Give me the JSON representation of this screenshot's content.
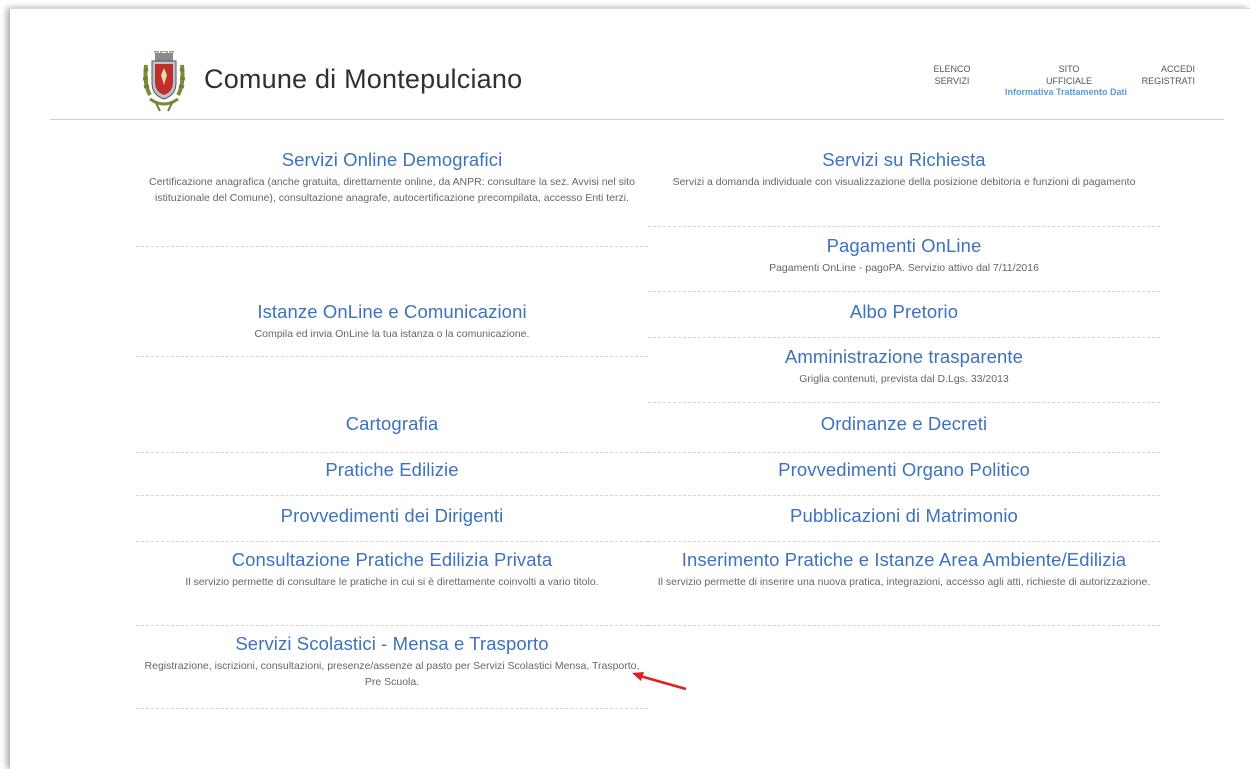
{
  "header": {
    "site_title": "Comune di Montepulciano",
    "nav": {
      "elenco_line1": "ELENCO",
      "elenco_line2": "SERVIZI",
      "sito_line1": "SITO",
      "sito_line2": "UFFICIALE",
      "accedi_line1": "ACCEDI",
      "accedi_line2": "REGISTRATI",
      "informativa": "Informativa Trattamento Dati"
    },
    "logo_icon": "coat-of-arms-icon"
  },
  "services_left": [
    {
      "title": "Servizi Online Demografici",
      "desc": "Certificazione anagrafica (anche gratuita, direttamente online, da ANPR: consultare la sez. Avvisi nel sito istituzionale del Comune), consultazione anagrafe, autocertificazione precompilata, accesso Enti terzi."
    },
    {
      "title": "Istanze OnLine e Comunicazioni",
      "desc": "Compila ed invia OnLine la tua istanza o la comunicazione."
    },
    {
      "title": "Cartografia"
    },
    {
      "title": "Pratiche Edilizie"
    },
    {
      "title": "Provvedimenti dei Dirigenti"
    },
    {
      "title": "Consultazione Pratiche Edilizia Privata",
      "desc": "Il servizio permette di consultare le pratiche in cui si è direttamente coinvolti a vario titolo."
    },
    {
      "title": "Servizi Scolastici - Mensa e Trasporto",
      "desc": "Registrazione, iscrizioni, consultazioni, presenze/assenze al pasto per Servizi Scolastici Mensa, Trasporto, Pre Scuola."
    }
  ],
  "services_right": [
    {
      "title": "Servizi su Richiesta",
      "desc": "Servizi a domanda individuale con visualizzazione della posizione debitoria e funzioni di pagamento"
    },
    {
      "title": "Pagamenti OnLine",
      "desc": "Pagamenti OnLine - pagoPA. Servizio attivo dal 7/11/2016"
    },
    {
      "title": "Albo Pretorio"
    },
    {
      "title": "Amministrazione trasparente",
      "desc": "Griglia contenuti, prevista dal D.Lgs. 33/2013"
    },
    {
      "title": "Ordinanze e Decreti"
    },
    {
      "title": "Provvedimenti Organo Politico"
    },
    {
      "title": "Pubblicazioni di Matrimonio"
    },
    {
      "title": "Inserimento Pratiche e Istanze Area Ambiente/Edilizia",
      "desc": "Il servizio permette di inserire una nuova pratica, integrazioni, accesso agli atti, richieste di autorizzazione."
    }
  ],
  "colors": {
    "link": "#3c72bf",
    "info_link": "#5a9ad8",
    "annotation_arrow": "#e02020"
  },
  "annotation": {
    "icon": "red-arrow-annotation-icon"
  }
}
